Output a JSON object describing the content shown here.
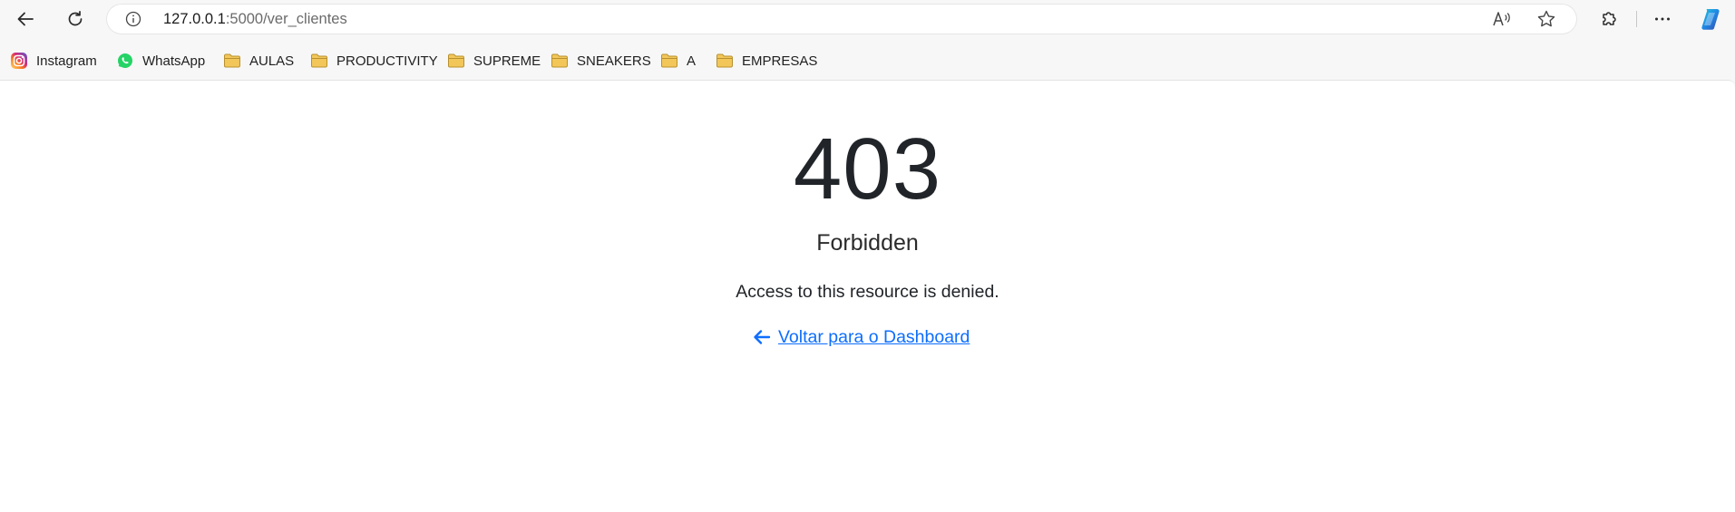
{
  "browser": {
    "url_host": "127.0.0.1",
    "url_rest": ":5000/ver_clientes",
    "icons": {
      "back": "back-arrow-icon",
      "refresh": "refresh-icon",
      "info": "site-info-icon",
      "read_aloud": "read-aloud-icon",
      "favorite": "star-icon",
      "extensions": "puzzle-icon",
      "menu": "more-icon",
      "copilot": "copilot-icon"
    }
  },
  "bookmarks": [
    {
      "label": "Instagram",
      "icon": "instagram-icon"
    },
    {
      "label": "WhatsApp",
      "icon": "whatsapp-icon"
    },
    {
      "label": "AULAS",
      "icon": "folder-icon"
    },
    {
      "label": "PRODUCTIVITY",
      "icon": "folder-icon"
    },
    {
      "label": "SUPREME",
      "icon": "folder-icon"
    },
    {
      "label": "SNEAKERS",
      "icon": "folder-icon"
    },
    {
      "label": "A",
      "icon": "folder-icon"
    },
    {
      "label": "EMPRESAS",
      "icon": "folder-icon"
    }
  ],
  "error": {
    "code": "403",
    "title": "Forbidden",
    "message": "Access to this resource is denied.",
    "back_link": "Voltar para o Dashboard"
  },
  "colors": {
    "link": "#0d6efd",
    "folder": "#f3c65a",
    "whatsapp": "#25d366",
    "copilot": "#1e88e5"
  }
}
